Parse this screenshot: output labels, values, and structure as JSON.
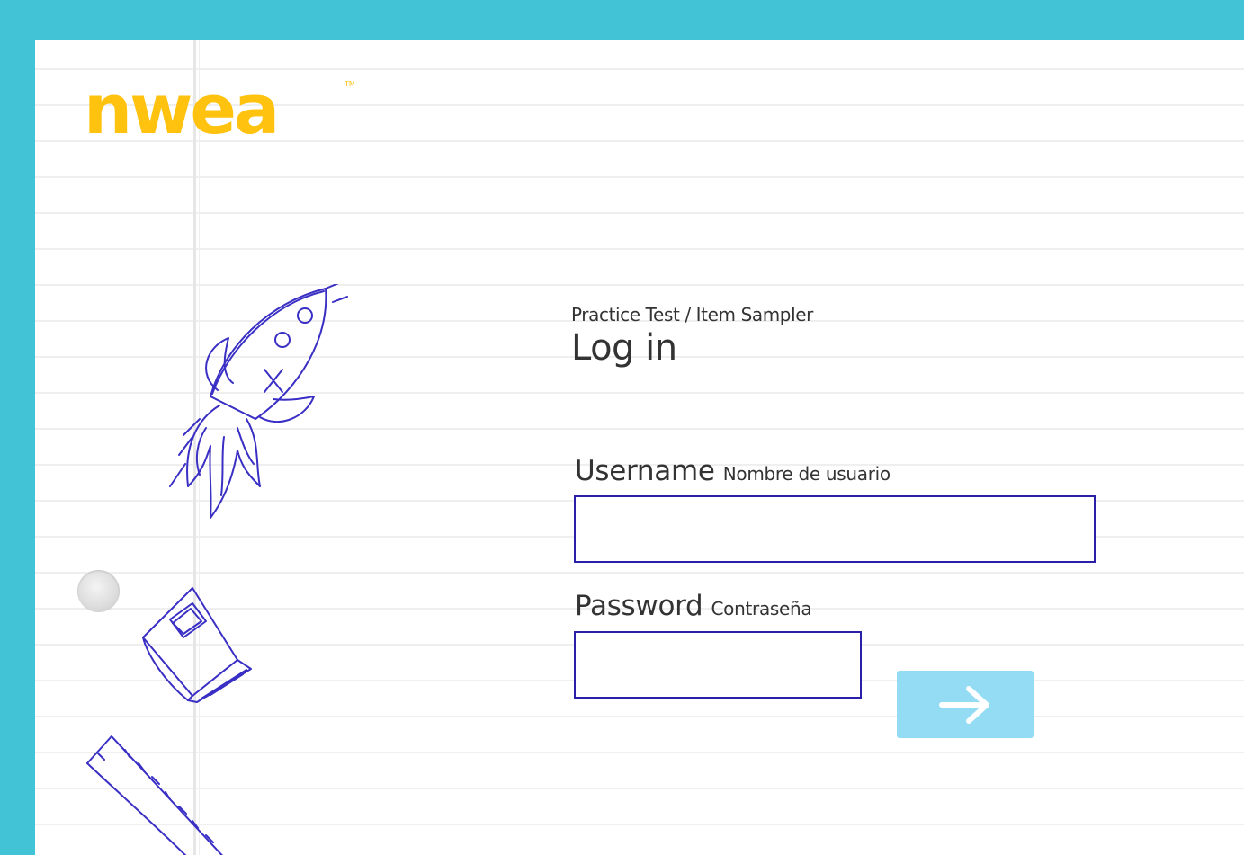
{
  "brand": {
    "logo_text": "nwea",
    "trademark": "TM",
    "color": "#ffc20e"
  },
  "colors": {
    "background": "#42c3d6",
    "input_border": "#2a1fa8",
    "button": "#93dcf4",
    "doodle_ink": "#3a2fc4"
  },
  "header": {
    "subtitle": "Practice Test / Item Sampler",
    "title": "Log in"
  },
  "form": {
    "username": {
      "label": "Username",
      "label_alt": "Nombre de usuario",
      "value": ""
    },
    "password": {
      "label": "Password",
      "label_alt": "Contraseña",
      "value": ""
    },
    "submit_icon": "arrow-right-icon"
  },
  "decorations": [
    "rocket-icon",
    "book-icon",
    "ruler-icon",
    "binder-hole"
  ]
}
